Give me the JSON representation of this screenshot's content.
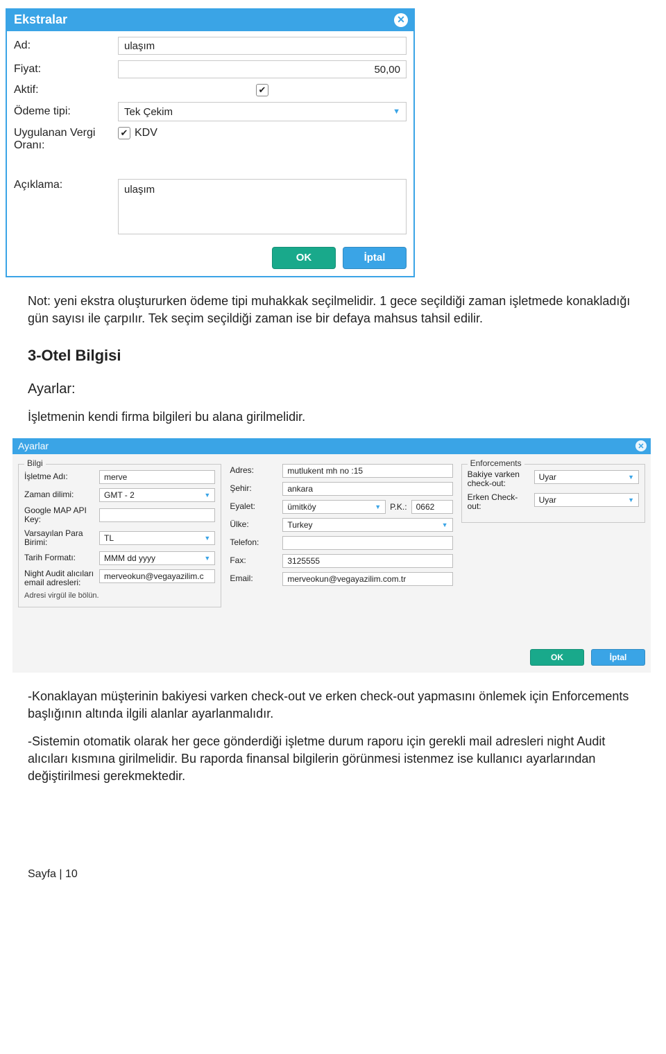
{
  "dialog1": {
    "title": "Ekstralar",
    "labels": {
      "ad": "Ad:",
      "fiyat": "Fiyat:",
      "aktif": "Aktif:",
      "odeme_tipi": "Ödeme tipi:",
      "vergi": "Uygulanan Vergi Oranı:",
      "aciklama": "Açıklama:"
    },
    "values": {
      "ad": "ulaşım",
      "fiyat": "50,00",
      "aktif_checked": "✔",
      "odeme_tipi": "Tek Çekim",
      "kdv_checked": "✔",
      "kdv_label": "KDV",
      "aciklama": "ulaşım"
    },
    "buttons": {
      "ok": "OK",
      "cancel": "İptal"
    }
  },
  "doc": {
    "note": "Not:  yeni ekstra oluştururken ödeme tipi muhakkak seçilmelidir. 1 gece seçildiği zaman işletmede konakladığı gün sayısı ile çarpılır. Tek seçim seçildiği zaman ise bir defaya mahsus tahsil edilir.",
    "h1": "3-Otel Bilgisi",
    "sub": "Ayarlar:",
    "p1": "İşletmenin kendi  firma bilgileri bu alana girilmelidir.",
    "p2": "-Konaklayan müşterinin bakiyesi varken check-out  ve erken check-out yapmasını önlemek için Enforcements başlığının altında ilgili alanlar ayarlanmalıdır.",
    "p3": "-Sistemin otomatik olarak her gece gönderdiği işletme durum raporu için gerekli  mail adresleri night Audit alıcıları kısmına girilmelidir. Bu raporda finansal bilgilerin görünmesi istenmez ise kullanıcı ayarlarından değiştirilmesi gerekmektedir.",
    "footer": "Sayfa | 10"
  },
  "dialog2": {
    "title": "Ayarlar",
    "groups": {
      "bilgi": "Bilgi",
      "enforcements": "Enforcements"
    },
    "labels": {
      "isletme_adi": "İşletme Adı:",
      "zaman_dilimi": "Zaman dilimi:",
      "google_api": "Google MAP API Key:",
      "para_birimi": "Varsayılan Para Birimi:",
      "tarih_format": "Tarih Formatı:",
      "night_audit": "Night Audit alıcıları email adresleri:",
      "adres_not": "Adresi virgül ile bölün.",
      "adres": "Adres:",
      "sehir": "Şehir:",
      "eyalet": "Eyalet:",
      "pk": "P.K.:",
      "ulke": "Ülke:",
      "telefon": "Telefon:",
      "fax": "Fax:",
      "email": "Email:",
      "bakiye_checkout": "Bakiye varken check-out:",
      "erken_checkout": "Erken Check-out:"
    },
    "values": {
      "isletme_adi": "merve",
      "zaman_dilimi": "GMT - 2",
      "google_api": "",
      "para_birimi": "TL",
      "tarih_format": "MMM dd yyyy",
      "night_audit": "merveokun@vegayazilim.c",
      "adres": "mutlukent mh no :15",
      "sehir": "ankara",
      "eyalet": "ümitköy",
      "pk": "0662",
      "ulke": "Turkey",
      "telefon": "",
      "fax": "3125555",
      "email": "merveokun@vegayazilim.com.tr",
      "bakiye_checkout": "Uyar",
      "erken_checkout": "Uyar"
    },
    "buttons": {
      "ok": "OK",
      "cancel": "İptal"
    }
  }
}
